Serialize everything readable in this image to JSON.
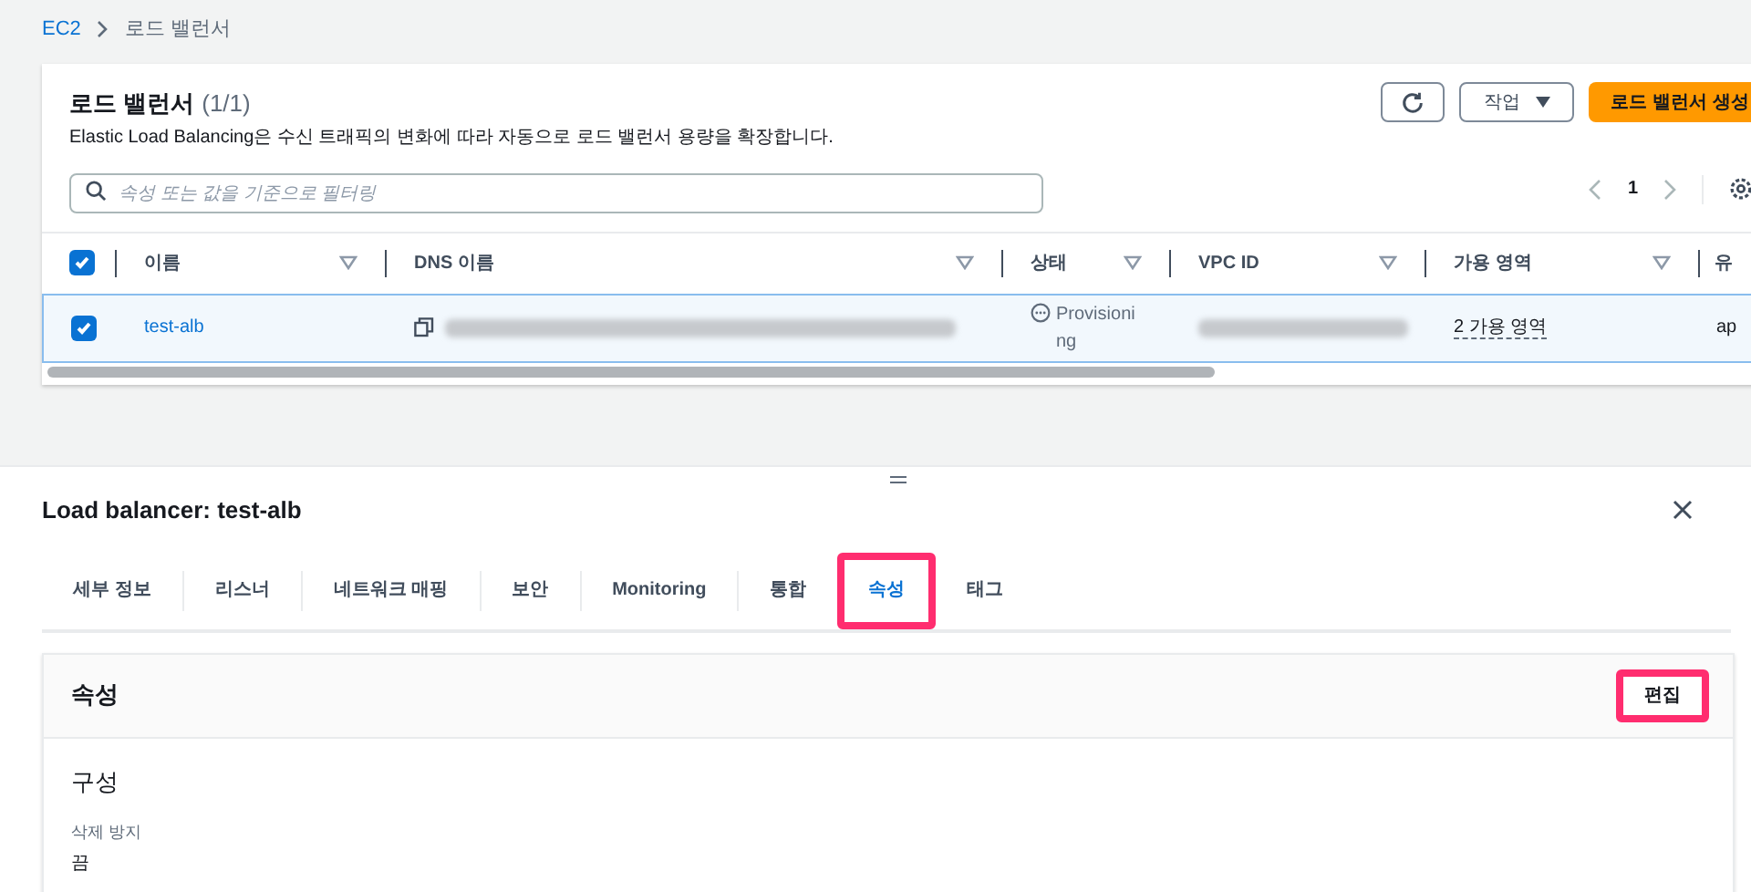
{
  "breadcrumb": [
    {
      "label": "EC2",
      "link": true
    },
    {
      "label": "로드 밸런서",
      "link": false
    }
  ],
  "list": {
    "title": "로드 밸런서",
    "count": "(1/1)",
    "description": "Elastic Load Balancing은 수신 트래픽의 변화에 따라 자동으로 로드 밸런서 용량을 확장합니다.",
    "actions_label": "작업",
    "create_label": "로드 밸런서 생성",
    "search": {
      "placeholder": "속성 또는 값을 기준으로 필터링"
    },
    "page": "1",
    "all_checked": true,
    "columns": [
      "이름",
      "DNS 이름",
      "상태",
      "VPC ID",
      "가용 영역",
      "유"
    ],
    "rows": [
      {
        "checked": true,
        "selected": true,
        "name": "test-alb",
        "status": "Provisioning",
        "zones": "2 가용 영역",
        "type": "ap"
      }
    ]
  },
  "detail": {
    "title": "Load balancer: test-alb",
    "tabs": [
      {
        "label": "세부 정보",
        "selected": false,
        "highlighted": false
      },
      {
        "label": "리스너",
        "selected": false,
        "highlighted": false
      },
      {
        "label": "네트워크 매핑",
        "selected": false,
        "highlighted": false
      },
      {
        "label": "보안",
        "selected": false,
        "highlighted": false
      },
      {
        "label": "Monitoring",
        "selected": false,
        "highlighted": false
      },
      {
        "label": "통합",
        "selected": false,
        "highlighted": false
      },
      {
        "label": "속성",
        "selected": true,
        "highlighted": true
      },
      {
        "label": "태그",
        "selected": false,
        "highlighted": false
      }
    ],
    "section": {
      "title": "속성",
      "edit_label": "편집",
      "edit_highlighted": true,
      "subtitle": "구성",
      "fields": [
        {
          "label": "삭제 방지",
          "value": "끔"
        }
      ]
    }
  }
}
